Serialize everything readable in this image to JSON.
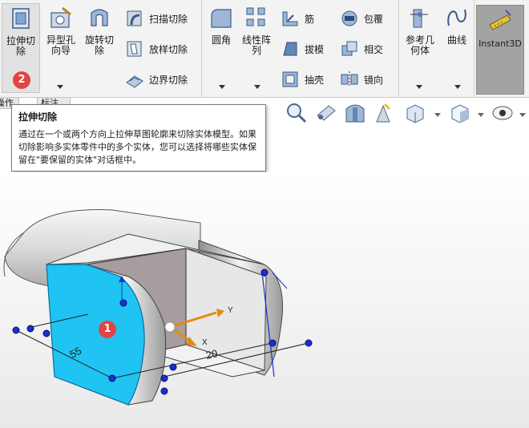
{
  "ribbon": {
    "buttons": {
      "extrude_cut": "拉伸切\n除",
      "hole_wizard": "异型孔\n向导",
      "revolve_cut": "旋转切\n除",
      "sweep_cut": "扫描切除",
      "loft_cut": "放样切除",
      "boundary_cut": "边界切除",
      "fillet": "圆角",
      "linear_pattern": "线性阵\n列",
      "rib": "筋",
      "wrap": "包覆",
      "draft": "拔模",
      "intersect": "相交",
      "shell": "抽壳",
      "mirror": "镜向",
      "reference_geometry": "参考几\n何体",
      "curves": "曲线",
      "instant3d": "Instant3D"
    }
  },
  "tabs": {
    "left": "操作",
    "right": "标注"
  },
  "badges": {
    "ribbon": "2",
    "model": "1"
  },
  "tooltip": {
    "title": "拉伸切除",
    "body": "通过在一个或两个方向上拉伸草图轮廓来切除实体模型。如果切除影响多实体零件中的多个实体，您可以选择将哪些实体保留在\"要保留的实体\"对话框中。"
  },
  "model": {
    "dim_labels": [
      "55",
      "20",
      "Y",
      "X"
    ]
  },
  "colors": {
    "selected_face": "#1fc4f2",
    "badge": "#e24444",
    "ribbon_bg": "#f3f3f3",
    "instant3d_bg": "#a3a3a3",
    "triad_arrow": "#e38a12"
  }
}
